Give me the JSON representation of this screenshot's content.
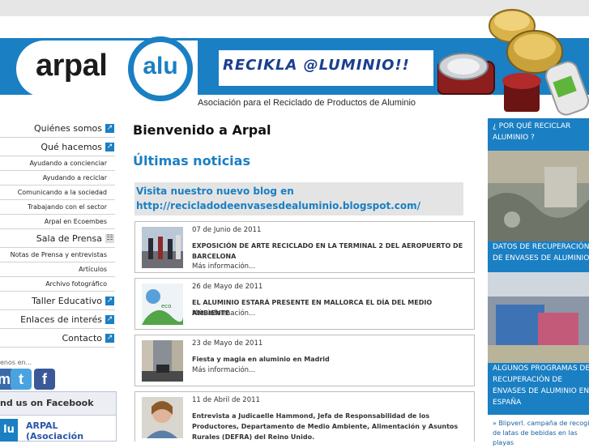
{
  "header": {
    "logo_word": "arpal",
    "logo_alu": "alu",
    "slogan": "RECIKLA @LUMINIO!!",
    "subtitle": "Asociación para el Reciclado de Productos de Aluminio"
  },
  "sidebar": {
    "items": [
      {
        "label": "Quiénes somos",
        "type": "main"
      },
      {
        "label": "Qué hacemos",
        "type": "main"
      },
      {
        "label": "Ayudando a concienciar",
        "type": "sub"
      },
      {
        "label": "Ayudando a reciclar",
        "type": "sub"
      },
      {
        "label": "Comunicando a la sociedad",
        "type": "sub"
      },
      {
        "label": "Trabajando con el sector",
        "type": "sub"
      },
      {
        "label": "Arpal en Ecoembes",
        "type": "sub"
      },
      {
        "label": "Sala de Prensa",
        "type": "main"
      },
      {
        "label": "Notas de Prensa y entrevistas",
        "type": "sub"
      },
      {
        "label": "Artículos",
        "type": "sub"
      },
      {
        "label": "Archivo fotográfico",
        "type": "sub"
      },
      {
        "label": "Taller Educativo",
        "type": "main"
      },
      {
        "label": "Enlaces de interés",
        "type": "main"
      },
      {
        "label": "Contacto",
        "type": "main"
      }
    ],
    "follow_text": "enos en...",
    "social_icons": [
      "myspace-icon",
      "twitter-icon",
      "facebook-icon"
    ],
    "facebook_box": {
      "header": "nd us on Facebook",
      "name_line1": "ARPAL",
      "name_line2": "(Asociación"
    }
  },
  "main": {
    "welcome": "Bienvenido a Arpal",
    "news_heading": "Últimas noticias",
    "blog_line1": "Visita nuestro nuevo blog en",
    "blog_line2": "http://recicladodeenvasesdealuminio.blogspot.com/",
    "news": [
      {
        "date": "07 de Junio de 2011",
        "title": "EXPOSICIÓN DE ARTE RECICLADO EN LA TERMINAL 2 DEL AEROPUERTO DE BARCELONA",
        "more": "Más información..."
      },
      {
        "date": "26 de Mayo de 2011",
        "title": "EL ALUMINIO ESTARÁ PRESENTE EN MALLORCA EL DÍA DEL MEDIO AMBIENTE",
        "more": "Más información..."
      },
      {
        "date": "23 de Mayo de 2011",
        "title": "Fiesta y magia en aluminio en Madrid",
        "more": "Más información..."
      },
      {
        "date": "11 de Abril de 2011",
        "title": "Entrevista a Judicaelle Hammond, Jefa de Responsabilidad de los Productores, Departamento de Medio Ambiente, Alimentación y Asuntos Rurales (DEFRA) del Reino Unido.",
        "more": ""
      }
    ]
  },
  "right": {
    "why": "¿ POR QUÉ RECICLAR ALUMINIO ?",
    "data": "DATOS DE RECUPERACIÓN DE ENVASES DE ALUMINIO",
    "programs": "ALGUNOS PROGRAMAS DE RECUPERACIÓN DE ENVASES DE ALUMINIO EN ESPAÑA",
    "footer_link": "» Blipverl. campaña de recogida de latas de bebidas en las playas"
  },
  "colors": {
    "brand_blue": "#1a7fc3",
    "dark_blue": "#1a3f8f"
  }
}
